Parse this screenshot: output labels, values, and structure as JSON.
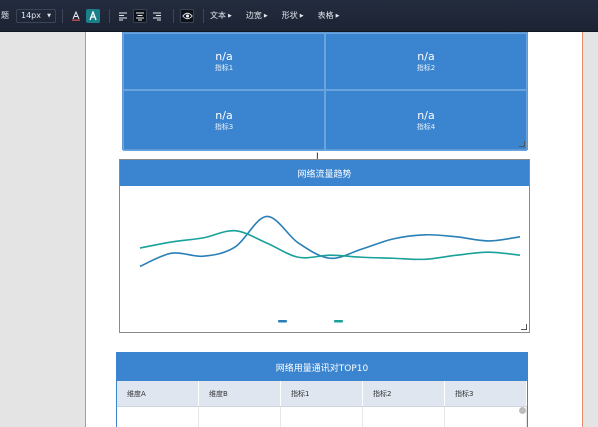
{
  "toolbar": {
    "cut_label": "题",
    "font_size": "14px",
    "menus": [
      "文本",
      "边宽",
      "形状",
      "表格"
    ]
  },
  "metrics": [
    {
      "value": "n/a",
      "label": "指标1"
    },
    {
      "value": "n/a",
      "label": "指标2"
    },
    {
      "value": "n/a",
      "label": "指标3"
    },
    {
      "value": "n/a",
      "label": "指标4"
    }
  ],
  "trend_chart": {
    "title": "网络流量趋势"
  },
  "top_table": {
    "title": "网络用量通讯对TOP10",
    "columns": [
      "维度A",
      "维度B",
      "指标1",
      "指标2",
      "指标3"
    ]
  },
  "colors": {
    "accent": "#3b84cf",
    "line1": "#2a7fb6",
    "line2": "#1aa19a",
    "toolbar_bg": "#1f2738"
  },
  "chart_data": {
    "type": "line",
    "title": "",
    "xlabel": "",
    "ylabel": "",
    "x": [
      0,
      1,
      2,
      3,
      4,
      5,
      6,
      7,
      8,
      9,
      10,
      11,
      12
    ],
    "series": [
      {
        "values": [
          0.29,
          0.42,
          0.39,
          0.48,
          0.78,
          0.52,
          0.37,
          0.46,
          0.56,
          0.6,
          0.58,
          0.54,
          0.58
        ]
      },
      {
        "values": [
          0.47,
          0.53,
          0.57,
          0.64,
          0.52,
          0.38,
          0.4,
          0.38,
          0.37,
          0.36,
          0.4,
          0.43,
          0.4
        ]
      }
    ],
    "ylim": [
      0,
      1
    ],
    "grid": false
  }
}
